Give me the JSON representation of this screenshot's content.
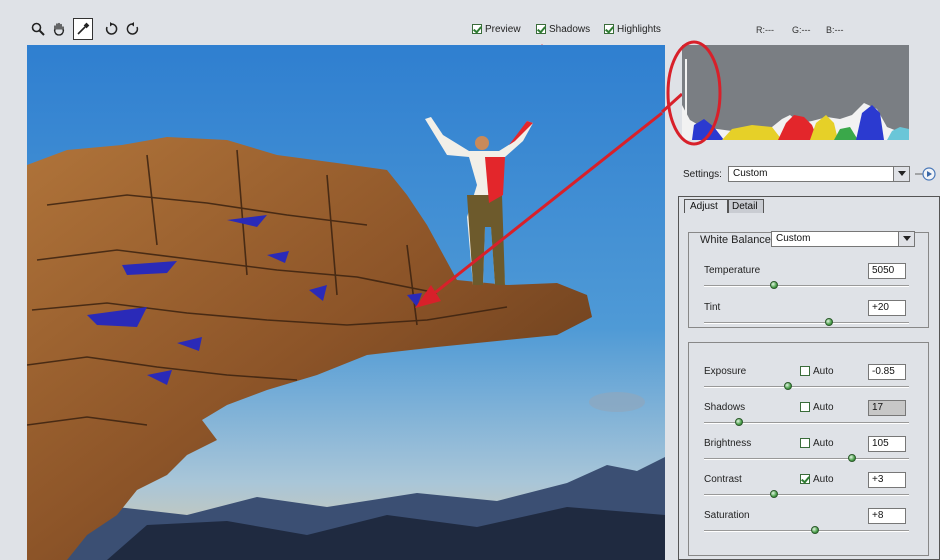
{
  "toolbar": {
    "tools": [
      "zoom-icon",
      "hand-icon",
      "eyedropper-icon",
      "rotate-left-icon",
      "rotate-right-icon"
    ],
    "preview_label": "Preview",
    "shadows_label": "Shadows",
    "highlights_label": "Highlights",
    "preview_checked": true,
    "shadows_checked": true,
    "highlights_checked": true,
    "r_readout": "R:---",
    "g_readout": "G:---",
    "b_readout": "B:---"
  },
  "settings": {
    "label": "Settings:",
    "value": "Custom"
  },
  "tabs": {
    "adjust": "Adjust",
    "detail": "Detail"
  },
  "white_balance": {
    "label": "White Balance:",
    "value": "Custom"
  },
  "controls": {
    "temperature": {
      "label": "Temperature",
      "value": "5050",
      "level": 0.34
    },
    "tint": {
      "label": "Tint",
      "value": "+20",
      "level": 0.61
    },
    "exposure": {
      "label": "Exposure",
      "value": "-0.85",
      "auto_label": "Auto",
      "auto": false,
      "level": 0.41
    },
    "shadows": {
      "label": "Shadows",
      "value": "17",
      "auto_label": "Auto",
      "auto": false,
      "level": 0.17
    },
    "brightness": {
      "label": "Brightness",
      "value": "105",
      "auto_label": "Auto",
      "auto": false,
      "level": 0.72
    },
    "contrast": {
      "label": "Contrast",
      "value": "+3",
      "auto_label": "Auto",
      "auto": true,
      "level": 0.34
    },
    "saturation": {
      "label": "Saturation",
      "value": "+8",
      "level": 0.54
    }
  },
  "colors": {
    "annotation_red": "#d8202a",
    "shadow_clip_blue": "#2a2ab8",
    "highlight_clip_red": "#e3262b",
    "slider_green": "#4aa04a"
  }
}
